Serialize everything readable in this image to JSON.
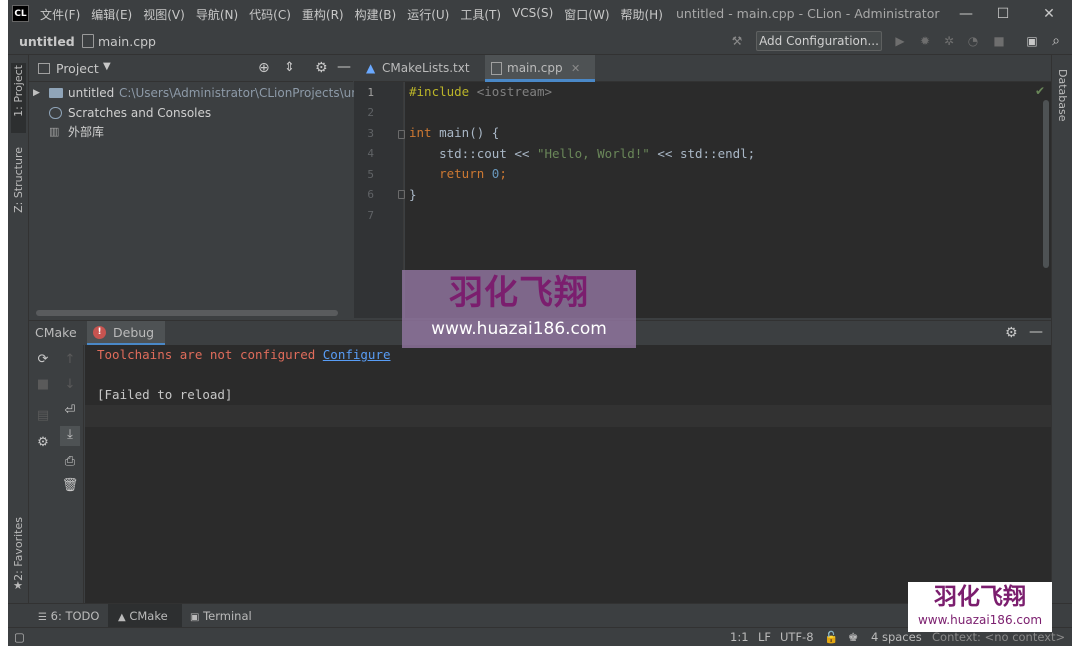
{
  "window": {
    "app_logo": "CL",
    "title": "untitled - main.cpp - CLion - Administrator",
    "controls": {
      "minimize": "—",
      "maximize": "☐",
      "close": "✕"
    }
  },
  "menu": [
    "文件(F)",
    "编辑(E)",
    "视图(V)",
    "导航(N)",
    "代码(C)",
    "重构(R)",
    "构建(B)",
    "运行(U)",
    "工具(T)",
    "VCS(S)",
    "窗口(W)",
    "帮助(H)"
  ],
  "navbar": {
    "project": "untitled",
    "file": "main.cpp",
    "add_configuration": "Add Configuration..."
  },
  "left_tabs": {
    "project": "1: Project",
    "structure": "Z: Structure",
    "favorites": "2: Favorites"
  },
  "right_tabs": {
    "database": "Database"
  },
  "project_panel": {
    "title": "Project",
    "tree": [
      {
        "label": "untitled",
        "path": "C:\\Users\\Administrator\\CLionProjects\\unti"
      },
      {
        "label": "Scratches and Consoles"
      },
      {
        "label": "外部库"
      }
    ]
  },
  "editor": {
    "tabs": [
      {
        "label": "CMakeLists.txt",
        "active": false
      },
      {
        "label": "main.cpp",
        "active": true
      }
    ],
    "line_numbers": [
      "1",
      "2",
      "3",
      "4",
      "5",
      "6",
      "7"
    ],
    "code": {
      "l1_pp": "#include",
      "l1_hdr": "<iostream>",
      "l3_kw": "int",
      "l3_rest": "main() {",
      "l4_a": "std::cout << ",
      "l4_str": "\"Hello, World!\"",
      "l4_b": " << std::endl;",
      "l5_kw": "return",
      "l5_num": "0",
      "l5_end": ";",
      "l6": "}"
    }
  },
  "bottom_panel": {
    "tabs": [
      {
        "label": "CMake"
      },
      {
        "label": "Debug"
      }
    ],
    "console": {
      "error": "Toolchains are not configured",
      "link": "Configure",
      "failed": "[Failed to reload]"
    }
  },
  "bottom_tabs": [
    {
      "label": "6: TODO"
    },
    {
      "label": "CMake"
    },
    {
      "label": "Terminal"
    }
  ],
  "status": {
    "position": "1:1",
    "line_ending": "LF",
    "encoding": "UTF-8",
    "indent": "4 spaces",
    "context": "Context: <no context>"
  },
  "watermark": {
    "brand": "羽化飞翔",
    "url": "www.huazai186.com"
  },
  "colors": {
    "error_text": "#e06c5b",
    "link": "#589df6",
    "active_tab_underline": "#4a88c7"
  }
}
